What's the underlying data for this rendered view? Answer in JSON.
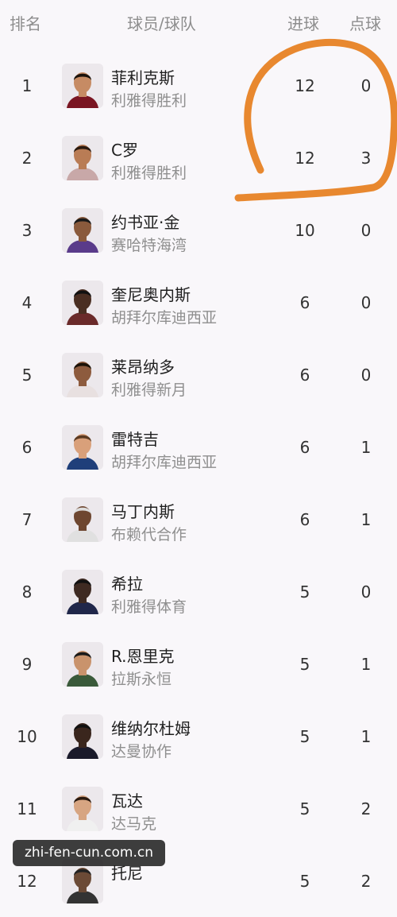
{
  "header": {
    "rank": "排名",
    "player_team": "球员/球队",
    "goals": "进球",
    "penalties": "点球"
  },
  "rows": [
    {
      "rank": "1",
      "name": "菲利克斯",
      "team": "利雅得胜利",
      "goals": "12",
      "penalties": "0"
    },
    {
      "rank": "2",
      "name": "C罗",
      "team": "利雅得胜利",
      "goals": "12",
      "penalties": "3"
    },
    {
      "rank": "3",
      "name": "约书亚·金",
      "team": "赛哈特海湾",
      "goals": "10",
      "penalties": "0"
    },
    {
      "rank": "4",
      "name": "奎尼奥内斯",
      "team": "胡拜尔库迪西亚",
      "goals": "6",
      "penalties": "0"
    },
    {
      "rank": "5",
      "name": "莱昂纳多",
      "team": "利雅得新月",
      "goals": "6",
      "penalties": "0"
    },
    {
      "rank": "6",
      "name": "雷特吉",
      "team": "胡拜尔库迪西亚",
      "goals": "6",
      "penalties": "1"
    },
    {
      "rank": "7",
      "name": "马丁内斯",
      "team": "布赖代合作",
      "goals": "6",
      "penalties": "1"
    },
    {
      "rank": "8",
      "name": "希拉",
      "team": "利雅得体育",
      "goals": "5",
      "penalties": "0"
    },
    {
      "rank": "9",
      "name": "R.恩里克",
      "team": "拉斯永恒",
      "goals": "5",
      "penalties": "1"
    },
    {
      "rank": "10",
      "name": "维纳尔杜姆",
      "team": "达曼协作",
      "goals": "5",
      "penalties": "1"
    },
    {
      "rank": "11",
      "name": "瓦达",
      "team": "达马克",
      "goals": "5",
      "penalties": "2"
    },
    {
      "rank": "12",
      "name": "托尼",
      "team": "",
      "goals": "5",
      "penalties": "2"
    }
  ],
  "watermark": "zhi-fen-cun.com.cn",
  "colors": {
    "annotation": "#e8882f",
    "header_text": "#8d8d8d",
    "team_text": "#8f8f8f",
    "background": "#f9f7fa"
  }
}
